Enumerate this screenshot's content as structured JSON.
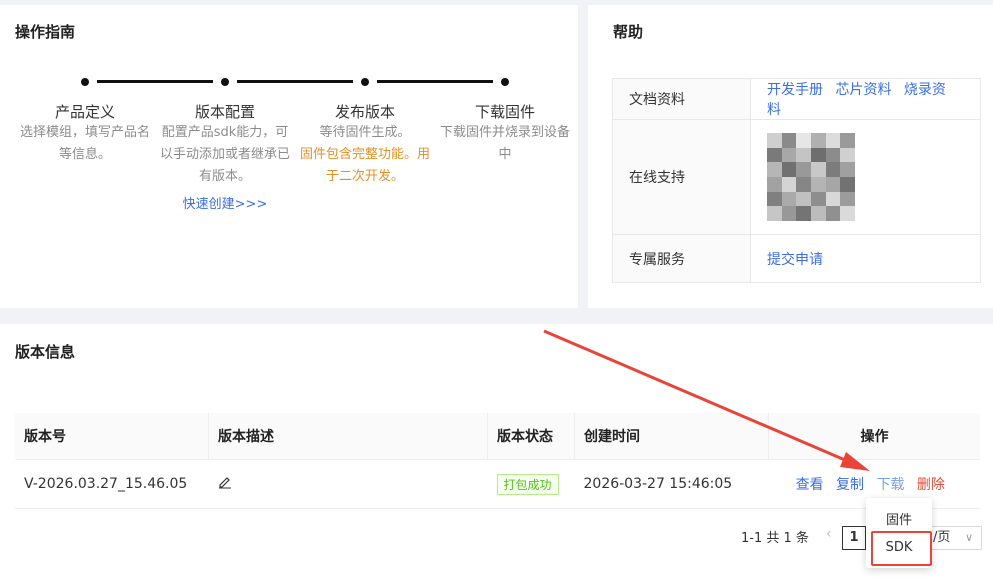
{
  "guide": {
    "title": "操作指南",
    "steps": [
      {
        "title": "产品定义",
        "desc": "选择模组，填写产品名",
        "desc2": "等信息。"
      },
      {
        "title": "版本配置",
        "desc": "配置产品sdk能力，可",
        "desc2": "以手动添加或者继承已",
        "desc3": "有版本。",
        "link": "快速创建>>>"
      },
      {
        "title": "发布版本",
        "desc": "等待固件生成。",
        "desc2": "固件包含完整功能。用",
        "desc3": "于二次开发。"
      },
      {
        "title": "下载固件",
        "desc": "下载固件并烧录到设备",
        "desc2": "中"
      }
    ]
  },
  "help": {
    "title": "帮助",
    "rows": [
      {
        "label": "文档资料",
        "links": [
          "开发手册",
          "芯片资料",
          "烧录资料"
        ]
      },
      {
        "label": "在线支持"
      },
      {
        "label": "专属服务",
        "links": [
          "提交申请"
        ]
      }
    ]
  },
  "version": {
    "title": "版本信息",
    "columns": [
      "版本号",
      "版本描述",
      "版本状态",
      "创建时间",
      "操作"
    ],
    "rows": [
      {
        "version": "V-2026.03.27_15.46.05",
        "status": "打包成功",
        "created": "2026-03-27 15:46:05",
        "actions": {
          "view": "查看",
          "copy": "复制",
          "download": "下载",
          "delete": "删除"
        }
      }
    ]
  },
  "pagination": {
    "summary": "1-1 共 1 条",
    "current": "1",
    "page_size_suffix": "/页"
  },
  "download_menu": {
    "items": [
      "固件",
      "SDK"
    ]
  },
  "colors": {
    "link": "#3a6ee8",
    "orange": "#e09227",
    "danger": "#e04a3a",
    "success": "#52c41a",
    "annotation": "#e8443a"
  }
}
